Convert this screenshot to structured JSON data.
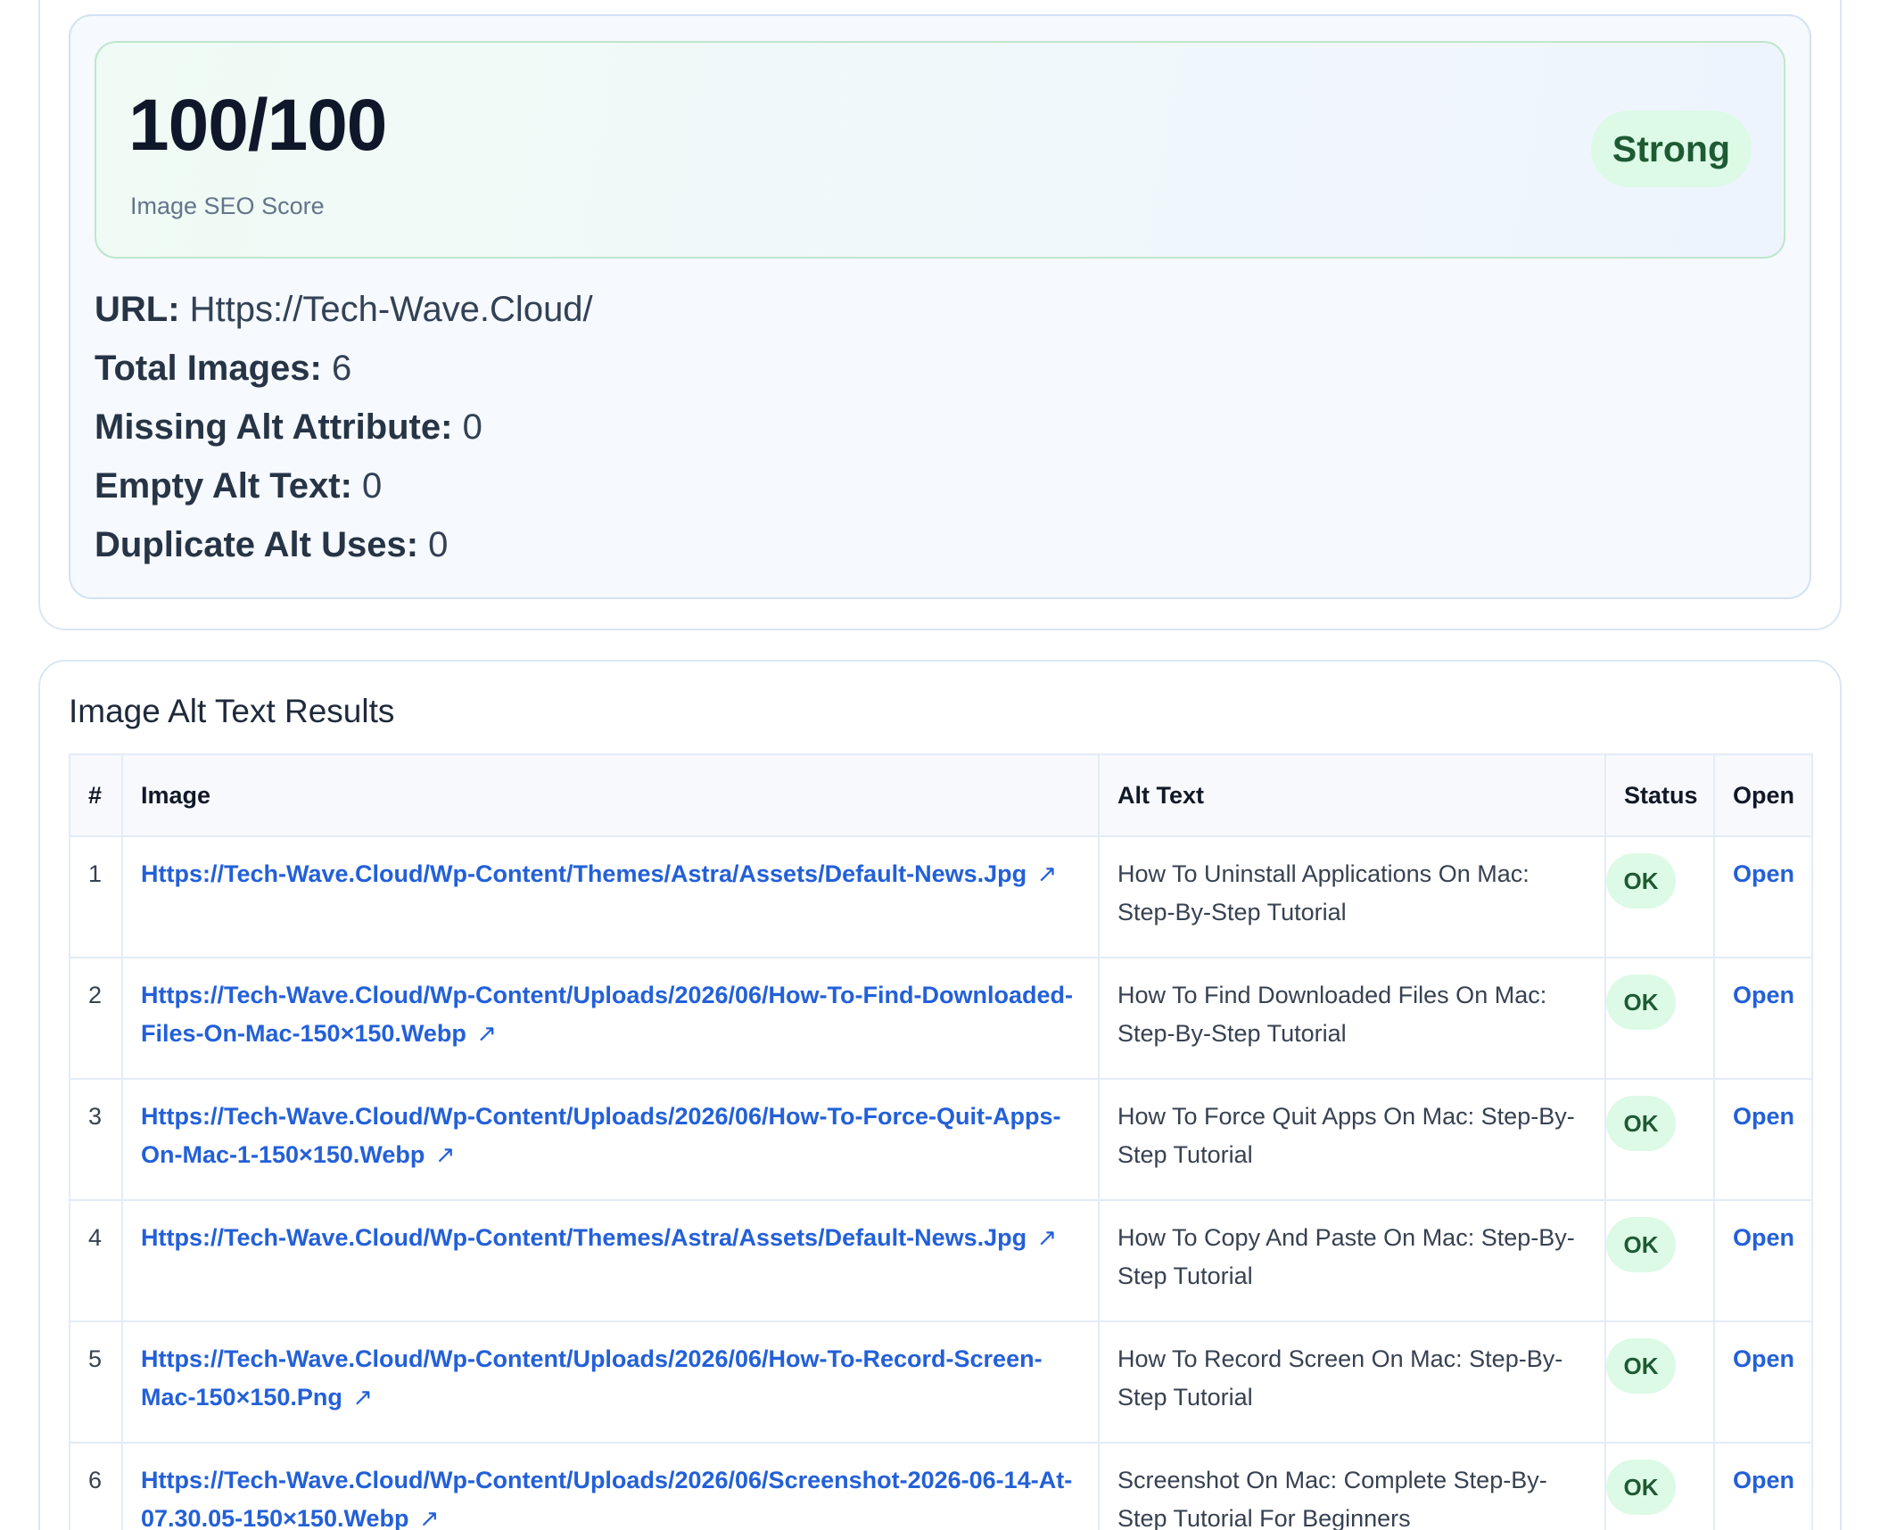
{
  "summary": {
    "score": "100/100",
    "score_label": "Image SEO Score",
    "badge": "Strong",
    "stats": [
      {
        "label": "URL:",
        "value": "Https://Tech-Wave.Cloud/"
      },
      {
        "label": "Total Images:",
        "value": "6"
      },
      {
        "label": "Missing Alt Attribute:",
        "value": "0"
      },
      {
        "label": "Empty Alt Text:",
        "value": "0"
      },
      {
        "label": "Duplicate Alt Uses:",
        "value": "0"
      }
    ]
  },
  "results": {
    "title": "Image Alt Text Results",
    "columns": [
      "#",
      "Image",
      "Alt Text",
      "Status",
      "Open"
    ],
    "link_arrow": "↗",
    "rows": [
      {
        "num": "1",
        "image": "Https://Tech-Wave.Cloud/Wp-Content/Themes/Astra/Assets/Default-News.Jpg",
        "alt": "How To Uninstall Applications On Mac: Step-By-Step Tutorial",
        "status": "OK",
        "open": "Open"
      },
      {
        "num": "2",
        "image": "Https://Tech-Wave.Cloud/Wp-Content/Uploads/2026/06/How-To-Find-Downloaded-Files-On-Mac-150×150.Webp",
        "alt": "How To Find Downloaded Files On Mac: Step-By-Step Tutorial",
        "status": "OK",
        "open": "Open"
      },
      {
        "num": "3",
        "image": "Https://Tech-Wave.Cloud/Wp-Content/Uploads/2026/06/How-To-Force-Quit-Apps-On-Mac-1-150×150.Webp",
        "alt": "How To Force Quit Apps On Mac: Step-By-Step Tutorial",
        "status": "OK",
        "open": "Open"
      },
      {
        "num": "4",
        "image": "Https://Tech-Wave.Cloud/Wp-Content/Themes/Astra/Assets/Default-News.Jpg",
        "alt": "How To Copy And Paste On Mac: Step-By-Step Tutorial",
        "status": "OK",
        "open": "Open"
      },
      {
        "num": "5",
        "image": "Https://Tech-Wave.Cloud/Wp-Content/Uploads/2026/06/How-To-Record-Screen-Mac-150×150.Png",
        "alt": "How To Record Screen On Mac: Step-By-Step Tutorial",
        "status": "OK",
        "open": "Open"
      },
      {
        "num": "6",
        "image": "Https://Tech-Wave.Cloud/Wp-Content/Uploads/2026/06/Screenshot-2026-06-14-At-07.30.05-150×150.Webp",
        "alt": "Screenshot On Mac: Complete Step-By-Step Tutorial For Beginners",
        "status": "OK",
        "open": "Open"
      }
    ]
  }
}
